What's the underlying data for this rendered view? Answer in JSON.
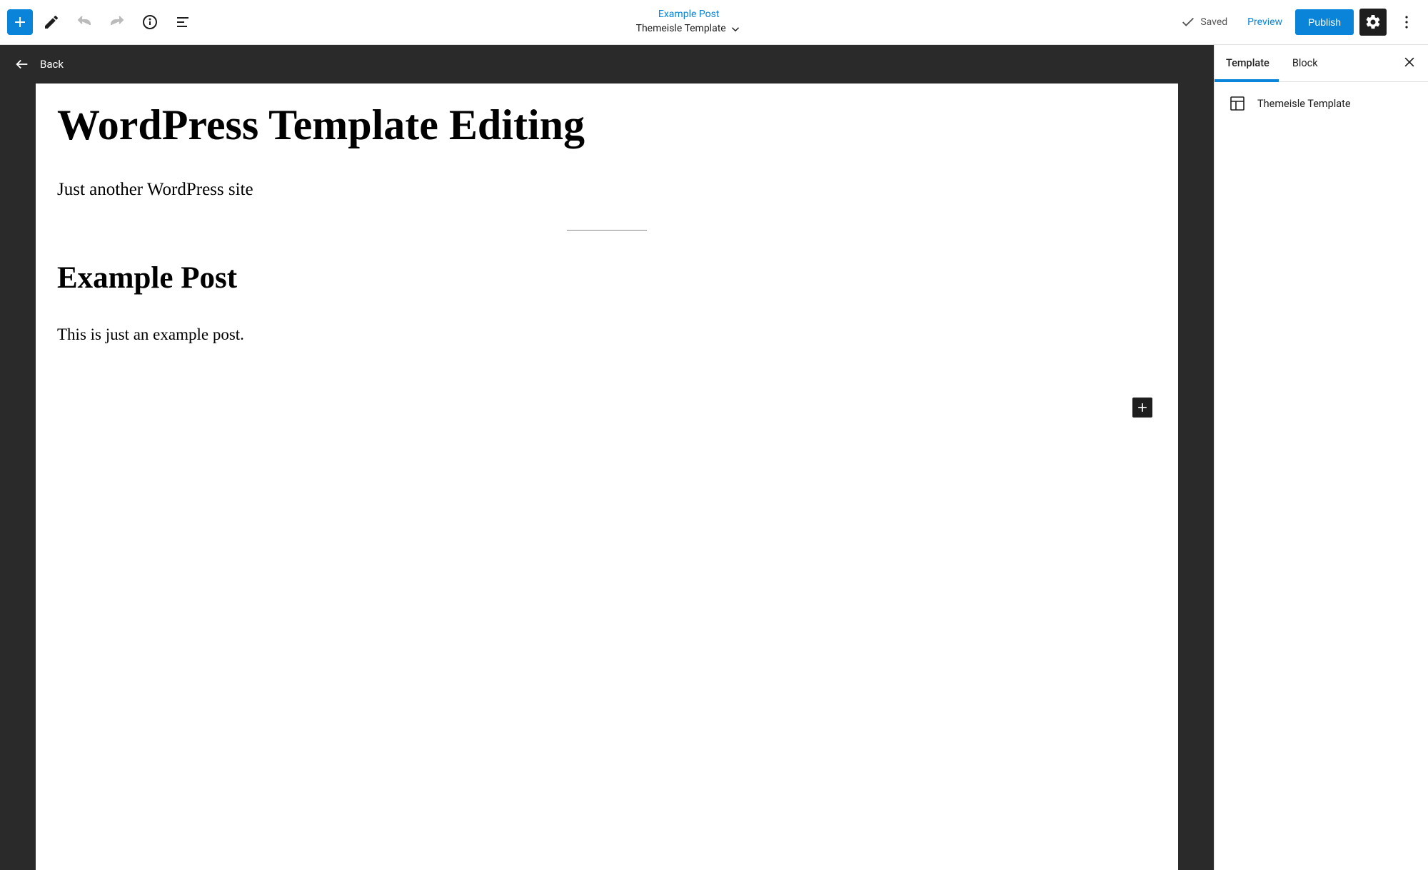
{
  "topbar": {
    "post_title": "Example Post",
    "template_name": "Themeisle Template",
    "saved_label": "Saved",
    "preview_label": "Preview",
    "publish_label": "Publish"
  },
  "editor": {
    "back_label": "Back",
    "site_title": "WordPress Template Editing",
    "tagline": "Just another WordPress site",
    "post_heading": "Example Post",
    "post_body": "This is just an example post."
  },
  "sidebar": {
    "tabs": {
      "template": "Template",
      "block": "Block"
    },
    "current_template": "Themeisle Template"
  }
}
